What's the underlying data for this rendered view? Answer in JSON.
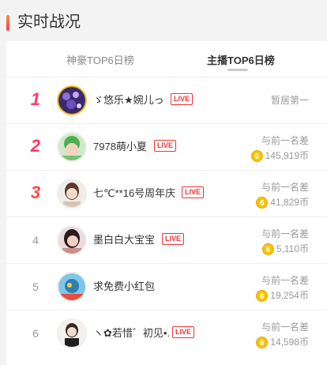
{
  "header": {
    "title": "实时战况"
  },
  "tabs": [
    {
      "label": "神豪TOP6日榜",
      "active": false
    },
    {
      "label": "主播TOP6日榜",
      "active": true
    }
  ],
  "diff_label": "与前一名差",
  "first_label": "暂居第一",
  "live_badge": "LIVE",
  "coin_glyph": "6",
  "rows": [
    {
      "rank": "1",
      "name": "ゞ悠乐★婉儿っ",
      "live": true,
      "diff": ""
    },
    {
      "rank": "2",
      "name": "7978萌小夏",
      "live": true,
      "diff": "145,919币"
    },
    {
      "rank": "3",
      "name": "七℃**16号周年庆",
      "live": true,
      "diff": "41,829币"
    },
    {
      "rank": "4",
      "name": "墨白白大宝宝",
      "live": true,
      "diff": "5,110币"
    },
    {
      "rank": "5",
      "name": "求免费小红包",
      "live": false,
      "diff": "19,254币"
    },
    {
      "rank": "6",
      "name": "ヽ✿若惜゛初见•.",
      "live": true,
      "diff": "14,598币"
    }
  ],
  "colors": {
    "accent": "#ff3a6c",
    "live": "#ee3333",
    "coin": "#f8c400"
  }
}
